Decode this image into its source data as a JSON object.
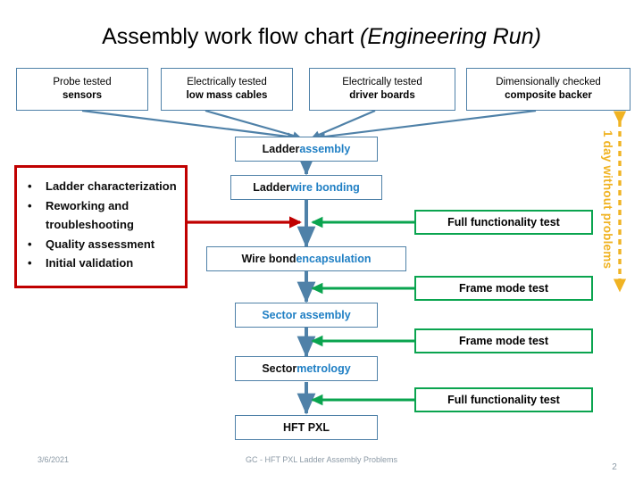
{
  "slide": {
    "title_main": "Assembly work flow chart ",
    "title_italic": "(Engineering Run)"
  },
  "colors": {
    "blue_border": "#4f81a8",
    "blue_text": "#1f7fc4",
    "green": "#0aa44f",
    "red": "#c00000",
    "gold": "#f0b323",
    "black": "#0d0d0d",
    "footer_gray": "#8c9aa6"
  },
  "inputs": {
    "boxes": [
      {
        "line1": "Probe tested",
        "line2": "sensors"
      },
      {
        "line1": "Electrically tested",
        "line2": "low mass cables"
      },
      {
        "line1": "Electrically tested",
        "line2": "driver boards"
      },
      {
        "line1": "Dimensionally checked",
        "line2": "composite backer"
      }
    ]
  },
  "notes": {
    "items": [
      "Ladder characterization",
      "Reworking and troubleshooting",
      "Quality assessment",
      "Initial validation"
    ]
  },
  "flow": {
    "steps": [
      {
        "dark": "Ladder ",
        "blue": "assembly"
      },
      {
        "dark": "Ladder ",
        "blue": "wire bonding"
      },
      {
        "dark": "Wire bond ",
        "blue": "encapsulation"
      },
      {
        "dark": "",
        "blue": "Sector assembly"
      },
      {
        "dark": "Sector ",
        "blue": "metrology"
      },
      {
        "dark": "HFT PXL",
        "blue": ""
      }
    ]
  },
  "tests": {
    "boxes": [
      {
        "label": "Full functionality test"
      },
      {
        "label": "Frame mode test"
      },
      {
        "label": "Frame mode test"
      },
      {
        "label": "Full functionality test"
      }
    ]
  },
  "duration": {
    "label": "1 day without problems"
  },
  "footer": {
    "date": "3/6/2021",
    "center": "GC -  HFT PXL Ladder Assembly Problems",
    "page": "2"
  }
}
